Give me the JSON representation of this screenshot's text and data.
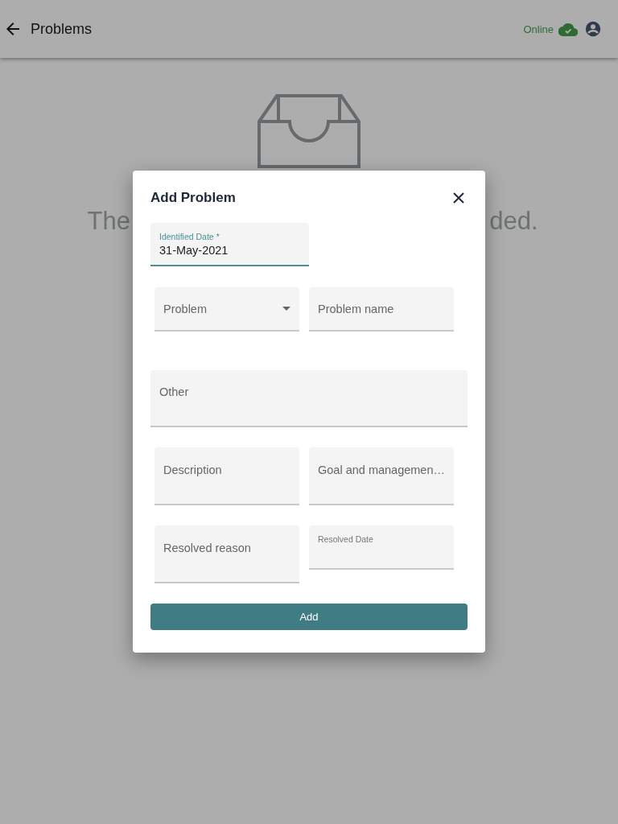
{
  "header": {
    "title": "Problems",
    "status": "Online"
  },
  "empty_state": {
    "text_left": "The",
    "text_right": "ded."
  },
  "dialog": {
    "title": "Add Problem",
    "rows": [
      [
        {
          "kind": "date",
          "label": "Identified Date *",
          "value": "31-May-2021",
          "focused": true
        }
      ],
      [
        {
          "kind": "select",
          "placeholder": "Problem",
          "focused": false
        },
        {
          "kind": "text",
          "placeholder": "Problem name",
          "focused": false
        }
      ],
      [
        {
          "kind": "wide",
          "placeholder": "Other",
          "focused": false
        }
      ],
      [
        {
          "kind": "text",
          "placeholder": "Description",
          "focused": false,
          "tall": true
        },
        {
          "kind": "text",
          "placeholder": "Goal and managemen…",
          "focused": false,
          "tall": true
        }
      ],
      [
        {
          "kind": "text",
          "placeholder": "Resolved reason",
          "focused": false,
          "tall": true
        },
        {
          "kind": "date",
          "label": "Resolved Date",
          "focused": false
        }
      ]
    ],
    "button": "Add"
  }
}
